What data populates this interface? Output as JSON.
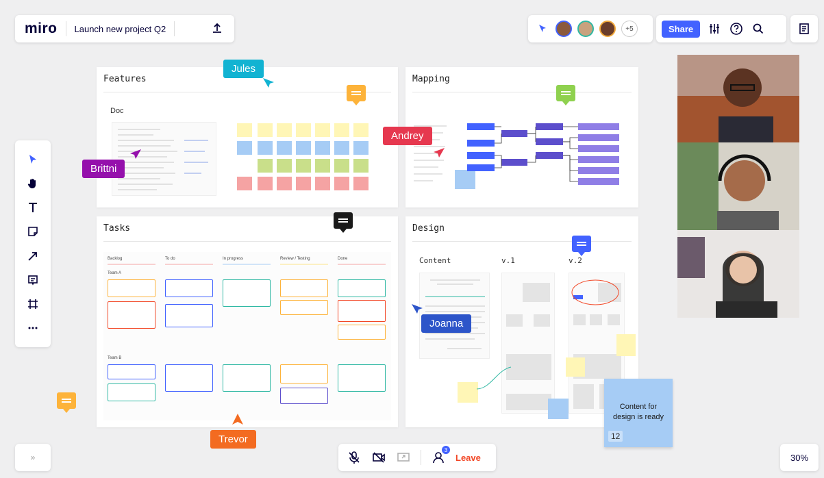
{
  "app": {
    "logo": "miro",
    "board_title": "Launch new project Q2"
  },
  "header": {
    "share_label": "Share",
    "collaborators_more": "+5"
  },
  "colors": {
    "brand_blue": "#4262ff",
    "leave_red": "#f24726"
  },
  "frames": {
    "features": {
      "title": "Features",
      "doc_label": "Doc"
    },
    "mapping": {
      "title": "Mapping"
    },
    "tasks": {
      "title": "Tasks",
      "columns": [
        "Backlog",
        "To do",
        "In progress",
        "Review / Testing",
        "Done"
      ],
      "teams": [
        "Team A",
        "Team B"
      ]
    },
    "design": {
      "title": "Design",
      "subtitles": [
        "Content",
        "v.1",
        "v.2"
      ]
    }
  },
  "cursors": {
    "jules": "Jules",
    "andrey": "Andrey",
    "brittni": "Brittni",
    "joanna": "Joanna",
    "trevor": "Trevor"
  },
  "sticky_note": {
    "text": "Content for design is ready",
    "count": "12"
  },
  "bottom": {
    "leave_label": "Leave",
    "participant_count": "3",
    "zoom": "30%",
    "expand": "»"
  }
}
